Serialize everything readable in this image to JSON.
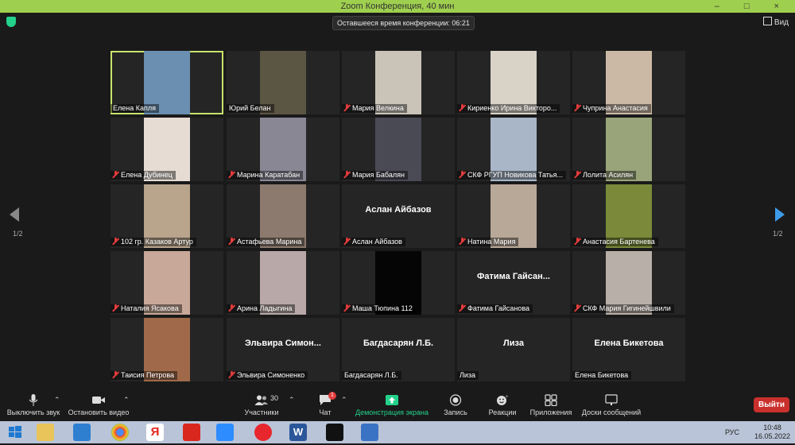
{
  "window": {
    "title": "Zoom Конференция, 40 мин",
    "controls": "–  □  ×"
  },
  "top": {
    "timer": "Оставшееся время конференции: 06:21",
    "view_label": "Вид"
  },
  "pagination": {
    "left": "1/2",
    "right": "1/2"
  },
  "tiles": [
    {
      "name": "Елена Капля",
      "big": "",
      "muted": false,
      "video": "#6a8fb0",
      "active": true
    },
    {
      "name": "Юрий Белан",
      "big": "",
      "muted": false,
      "video": "#5b5544",
      "active": false
    },
    {
      "name": "Мария Велкина",
      "big": "",
      "muted": true,
      "video": "#c9c3b8",
      "active": false
    },
    {
      "name": "Кириенко Ирина Викторо...",
      "big": "",
      "muted": true,
      "video": "#d8d2c7",
      "active": false
    },
    {
      "name": "Чуприна Анастасия",
      "big": "",
      "muted": true,
      "video": "#cbb9a6",
      "active": false
    },
    {
      "name": "Елена Дубинец",
      "big": "",
      "muted": true,
      "video": "#e6dcd4",
      "active": false
    },
    {
      "name": "Марина Каратабан",
      "big": "",
      "muted": true,
      "video": "#8a8795",
      "active": false
    },
    {
      "name": "Мария Бабалян",
      "big": "",
      "muted": true,
      "video": "#4a4a55",
      "active": false
    },
    {
      "name": "СКФ РГУП Новикова Татья...",
      "big": "",
      "muted": true,
      "video": "#a8b6c8",
      "active": false
    },
    {
      "name": "Лолита Асилян",
      "big": "",
      "muted": true,
      "video": "#9aa47a",
      "active": false
    },
    {
      "name": "102 гр. Казаков Артур",
      "big": "",
      "muted": true,
      "video": "#b9a48c",
      "active": false
    },
    {
      "name": "Астафьева Марина",
      "big": "",
      "muted": true,
      "video": "#8c7a6e",
      "active": false
    },
    {
      "name": "Аслан Айбазов",
      "big": "Аслан Айбазов",
      "muted": true,
      "video": "",
      "active": false
    },
    {
      "name": "Натина Мария",
      "big": "",
      "muted": true,
      "video": "#b8a898",
      "active": false
    },
    {
      "name": "Анастасия Бартенева",
      "big": "",
      "muted": true,
      "video": "#7a8a3a",
      "active": false
    },
    {
      "name": "Наталия Ясакова",
      "big": "",
      "muted": true,
      "video": "#c8a898",
      "active": false
    },
    {
      "name": "Арина Ладыгина",
      "big": "",
      "muted": true,
      "video": "#b8a8a8",
      "active": false
    },
    {
      "name": "Маша Тюпина 112",
      "big": "",
      "muted": true,
      "video": "#050505",
      "active": false
    },
    {
      "name": "Фатима Гайсанова",
      "big": "Фатима  Гайсан...",
      "muted": true,
      "video": "",
      "active": false
    },
    {
      "name": "СКФ Мария Гигинейшвили",
      "big": "",
      "muted": true,
      "video": "#b8b0a8",
      "active": false
    },
    {
      "name": "Таисия Петрова",
      "big": "",
      "muted": true,
      "video": "#a06a4a",
      "active": false
    },
    {
      "name": "Эльвира Симоненко",
      "big": "Эльвира  Симон...",
      "muted": true,
      "video": "",
      "active": false
    },
    {
      "name": "Багдасарян Л.Б.",
      "big": "Багдасарян Л.Б.",
      "muted": false,
      "video": "",
      "active": false
    },
    {
      "name": "Лиза",
      "big": "Лиза",
      "muted": false,
      "video": "",
      "active": false
    },
    {
      "name": "Елена Бикетова",
      "big": "Елена Бикетова",
      "muted": false,
      "video": "",
      "active": false
    }
  ],
  "toolbar": {
    "mute": "Выключить звук",
    "video": "Остановить видео",
    "participants_count": "30",
    "participants": "Участники",
    "chat": "Чат",
    "chat_badge": "1",
    "share": "Демонстрация экрана",
    "record": "Запись",
    "reactions": "Реакции",
    "apps": "Приложения",
    "whiteboards": "Доски сообщений",
    "leave": "Выйти"
  },
  "taskbar": {
    "lang": "РУС",
    "time": "10:48",
    "date": "16.05.2022"
  },
  "colors": {
    "titlebar": "#9fcf4e",
    "active_border": "#c9e36c",
    "muted_mic": "#e23c3c",
    "share_green": "#23d18b",
    "leave": "#c9302c"
  }
}
